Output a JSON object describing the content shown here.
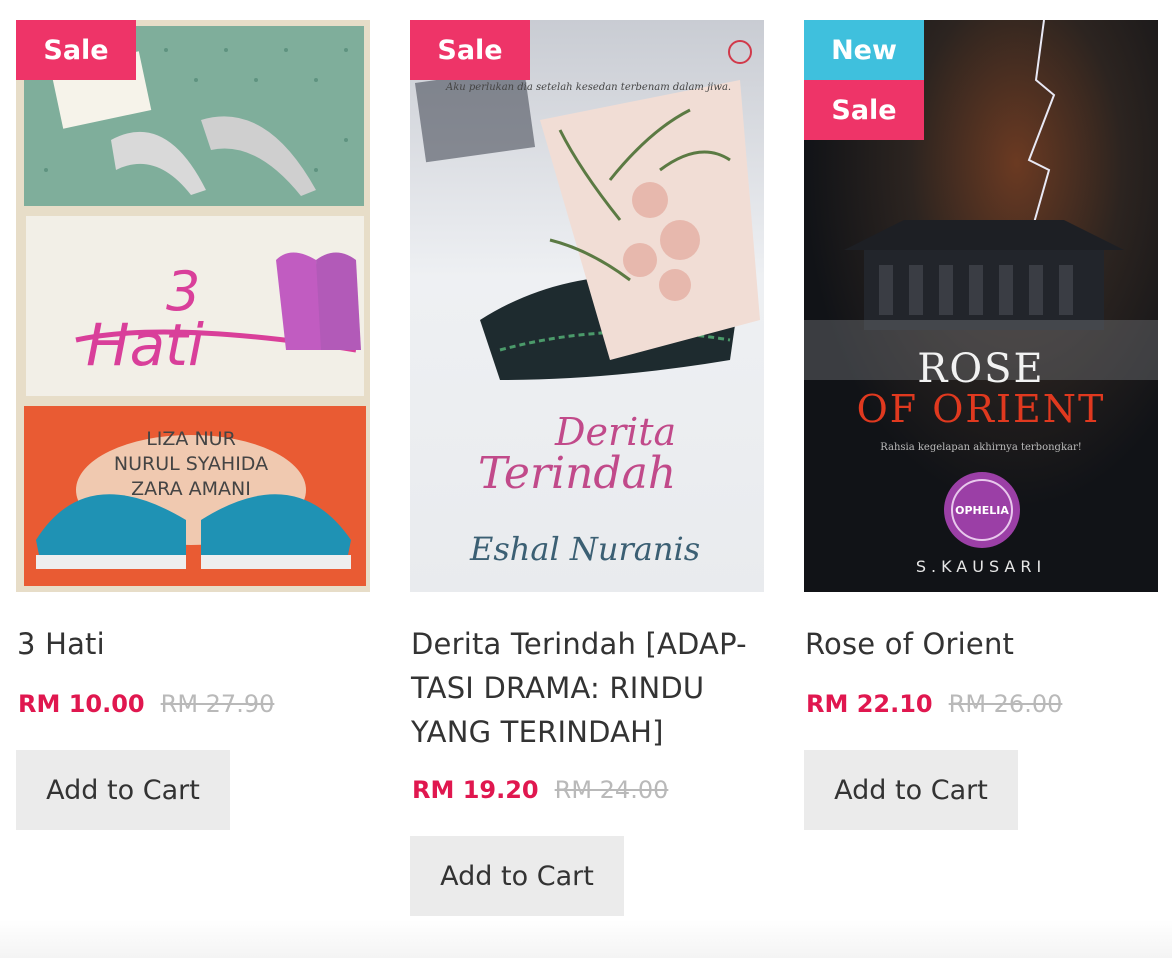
{
  "products": [
    {
      "badges": [
        "Sale"
      ],
      "title": "3 Hati",
      "price": "RM 10.00",
      "old_price": "RM 27.90",
      "button": "Add to Cart",
      "cover": {
        "lines": [
          "3",
          "Hati",
          "LIZA NUR",
          "NURUL SYAHIDA",
          "ZARA AMANI"
        ],
        "colors": {
          "top": "#7fae9b",
          "mid": "#f2efe7",
          "bottom": "#e95b33",
          "accent": "#d93f9a"
        }
      }
    },
    {
      "badges": [
        "Sale"
      ],
      "title": "Derita Terindah [ADAP-TASI DRAMA: RINDU YANG TERINDAH]",
      "price": "RM 19.20",
      "old_price": "RM 24.00",
      "button": "Add to Cart",
      "cover": {
        "lines": [
          "Derita",
          "Terindah",
          "Eshal Nuranis",
          "Aku perlukan dia setelah kesedan terbenam dalam jiwa."
        ],
        "colors": {
          "bg": "#e8ebef",
          "accent": "#c14a8a",
          "author": "#3b5f73"
        }
      }
    },
    {
      "badges": [
        "New",
        "Sale"
      ],
      "title": "Rose of Orient",
      "price": "RM 22.10",
      "old_price": "RM 26.00",
      "button": "Add to Cart",
      "cover": {
        "lines": [
          "ROSE",
          "OF ORIENT",
          "Rahsia kegelapan akhirnya terbongkar!",
          "OPHELIA",
          "S.KAUSARI"
        ],
        "colors": {
          "bg": "#15171c",
          "accent": "#e0391f",
          "seal": "#9b3fa6"
        }
      }
    }
  ]
}
